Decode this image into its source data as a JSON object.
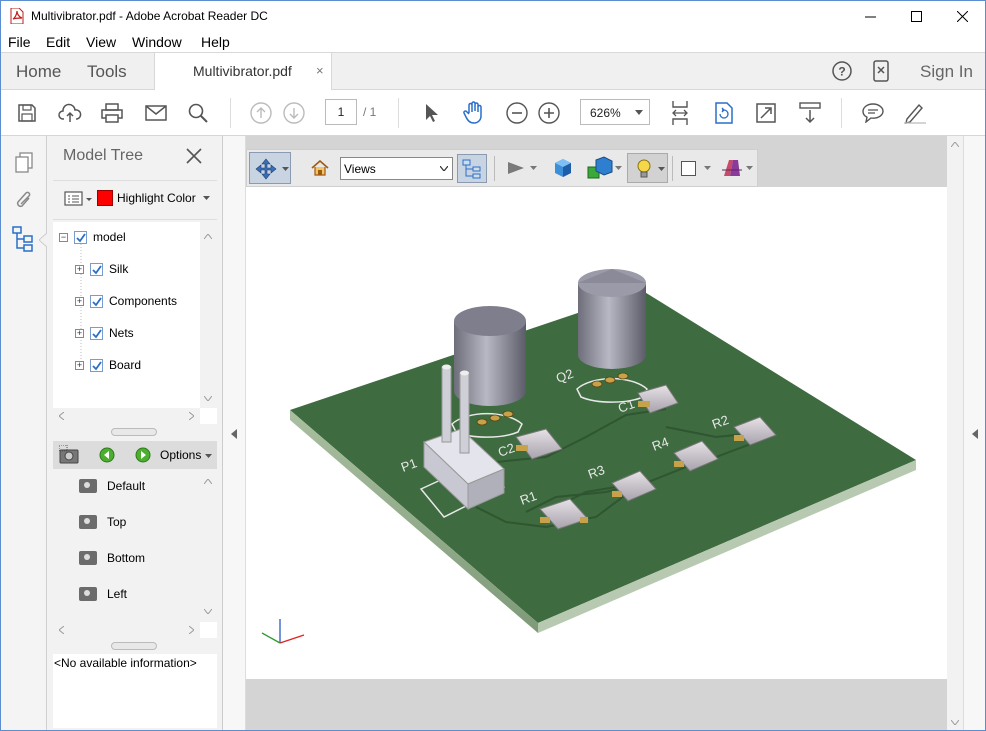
{
  "window": {
    "title": "Multivibrator.pdf - Adobe Acrobat Reader DC",
    "controls": [
      "minimize",
      "maximize",
      "close"
    ]
  },
  "menubar": [
    "File",
    "Edit",
    "View",
    "Window",
    "Help"
  ],
  "tabs": {
    "home": "Home",
    "tools": "Tools",
    "document": "Multivibrator.pdf",
    "sign_in": "Sign In"
  },
  "toolbar": {
    "page_current": "1",
    "page_total": "/ 1",
    "zoom": "626%"
  },
  "model_tree": {
    "title": "Model Tree",
    "highlight_label": "Highlight Color",
    "highlight_color": "#ff0000",
    "root": "model",
    "children": [
      "Silk",
      "Components",
      "Nets",
      "Board"
    ]
  },
  "views_panel": {
    "options_label": "Options",
    "items": [
      "Default",
      "Top",
      "Bottom",
      "Left"
    ]
  },
  "info_panel": {
    "text": "<No available information>"
  },
  "toolbar_3d": {
    "views_select": "Views"
  },
  "pcb": {
    "labels": [
      "Q2",
      "P1",
      "C2",
      "C1",
      "R1",
      "R2",
      "R3",
      "R4"
    ],
    "board_color": "#3e6b3f"
  }
}
